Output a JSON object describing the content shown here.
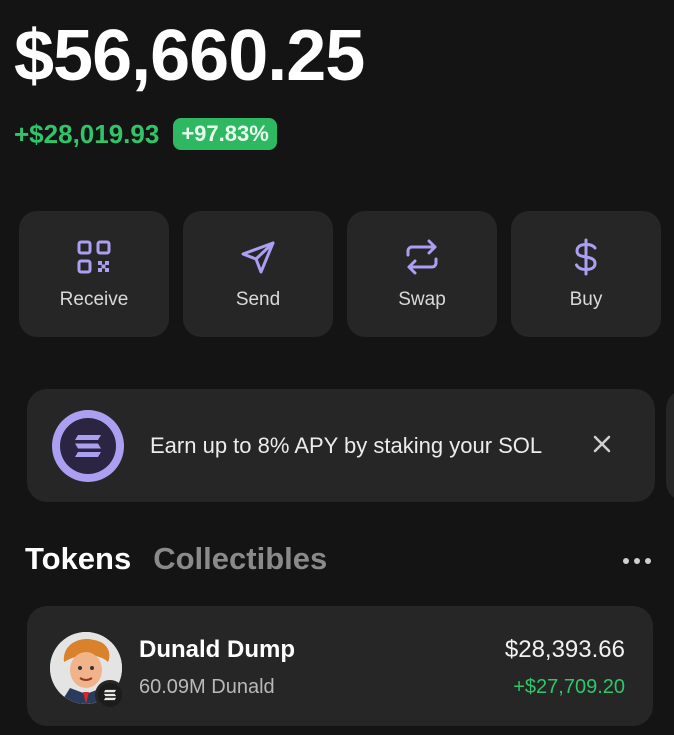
{
  "balance": {
    "total": "$56,660.25",
    "change_amount": "+$28,019.93",
    "change_percent": "+97.83%"
  },
  "actions": [
    {
      "label": "Receive",
      "icon": "qr-code-icon"
    },
    {
      "label": "Send",
      "icon": "send-arrow-icon"
    },
    {
      "label": "Swap",
      "icon": "swap-arrows-icon"
    },
    {
      "label": "Buy",
      "icon": "dollar-icon"
    }
  ],
  "banner": {
    "text": "Earn up to 8% APY by staking your SOL",
    "icon": "solana-logo-icon",
    "close_icon": "close-icon"
  },
  "tabs": [
    {
      "label": "Tokens",
      "active": true
    },
    {
      "label": "Collectibles",
      "active": false
    }
  ],
  "more_icon": "more-horizontal-icon",
  "tokens": [
    {
      "name": "Dunald Dump",
      "quantity": "60.09M Dunald",
      "value": "$28,393.66",
      "change": "+$27,709.20",
      "icon": "token-avatar-icon",
      "chain_icon": "solana-chain-icon"
    }
  ],
  "colors": {
    "background": "#141414",
    "card": "#262626",
    "accent": "#ab9ff2",
    "positive": "#2fc66a"
  }
}
